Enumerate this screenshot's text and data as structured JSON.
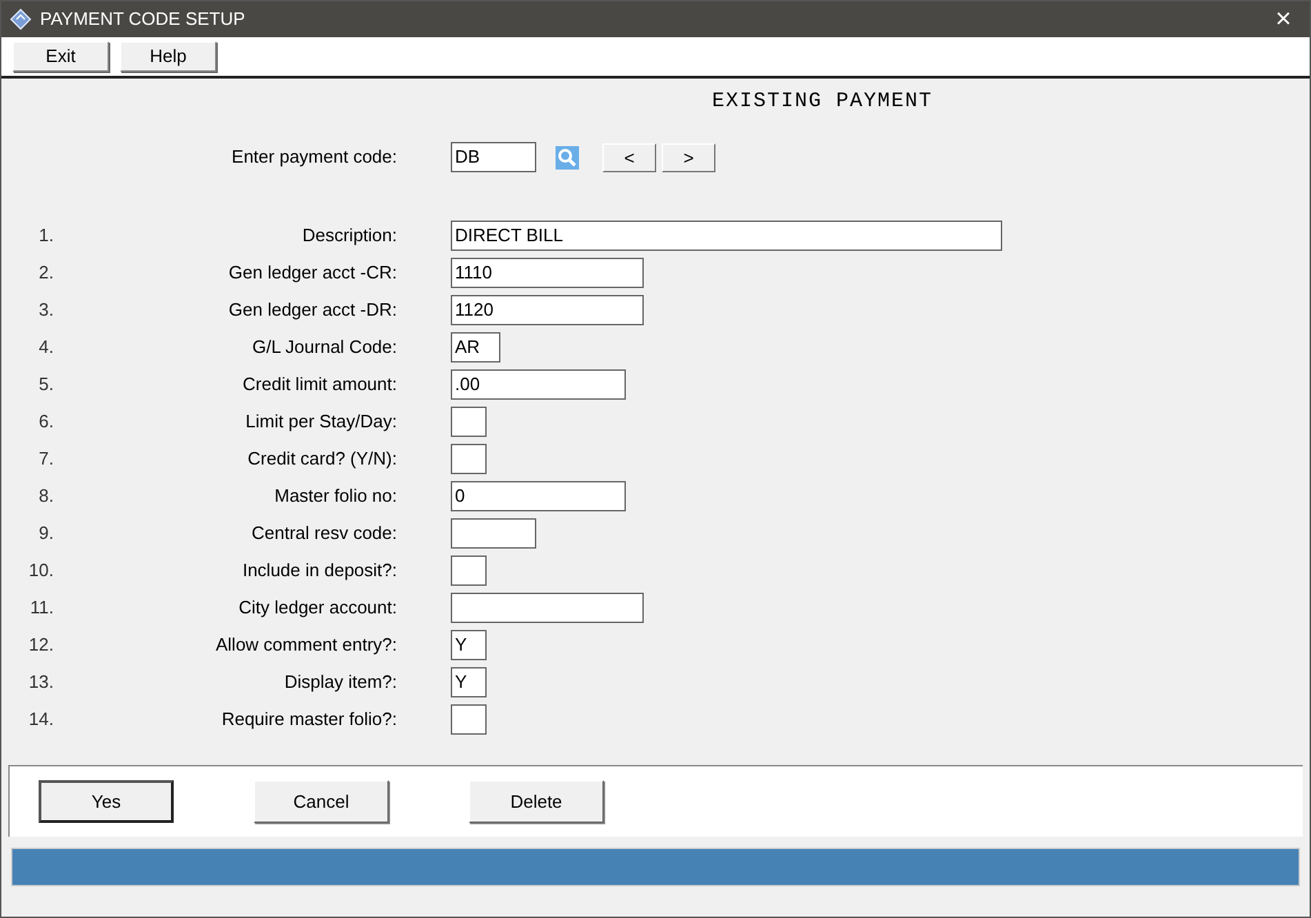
{
  "window": {
    "title": "PAYMENT CODE SETUP",
    "close": "×"
  },
  "toolbar": [
    "Exit",
    "Help"
  ],
  "heading": "EXISTING PAYMENT",
  "lookup": {
    "label": "Enter payment code:",
    "value": "DB",
    "prev": "<",
    "next": ">"
  },
  "fields": [
    {
      "number": "1.",
      "label": "Description:",
      "value": "DIRECT BILL"
    },
    {
      "number": "2.",
      "label": "Gen ledger acct -CR:",
      "value": "1110"
    },
    {
      "number": "3.",
      "label": "Gen ledger acct -DR:",
      "value": "1120"
    },
    {
      "number": "4.",
      "label": "G/L Journal Code:",
      "value": "AR"
    },
    {
      "number": "5.",
      "label": "Credit limit amount:",
      "value": ".00"
    },
    {
      "number": "6.",
      "label": "Limit per Stay/Day:"
    },
    {
      "number": "7.",
      "label": "Credit card? (Y/N):"
    },
    {
      "number": "8.",
      "label": "Master folio no:",
      "value": "0"
    },
    {
      "number": "9.",
      "label": "Central resv code:"
    },
    {
      "number": "10.",
      "label": "Include in deposit?:"
    },
    {
      "number": "11.",
      "label": "City ledger account:"
    },
    {
      "number": "12.",
      "label": "Allow comment entry?:",
      "value": "Y"
    },
    {
      "number": "13.",
      "label": "Display item?:",
      "value": "Y"
    },
    {
      "number": "14.",
      "label": "Require master folio?:"
    }
  ],
  "buttons": [
    {
      "label": "Yes",
      "default": true
    },
    {
      "label": "Cancel",
      "default": false
    },
    {
      "label": "Delete",
      "default": false
    }
  ]
}
